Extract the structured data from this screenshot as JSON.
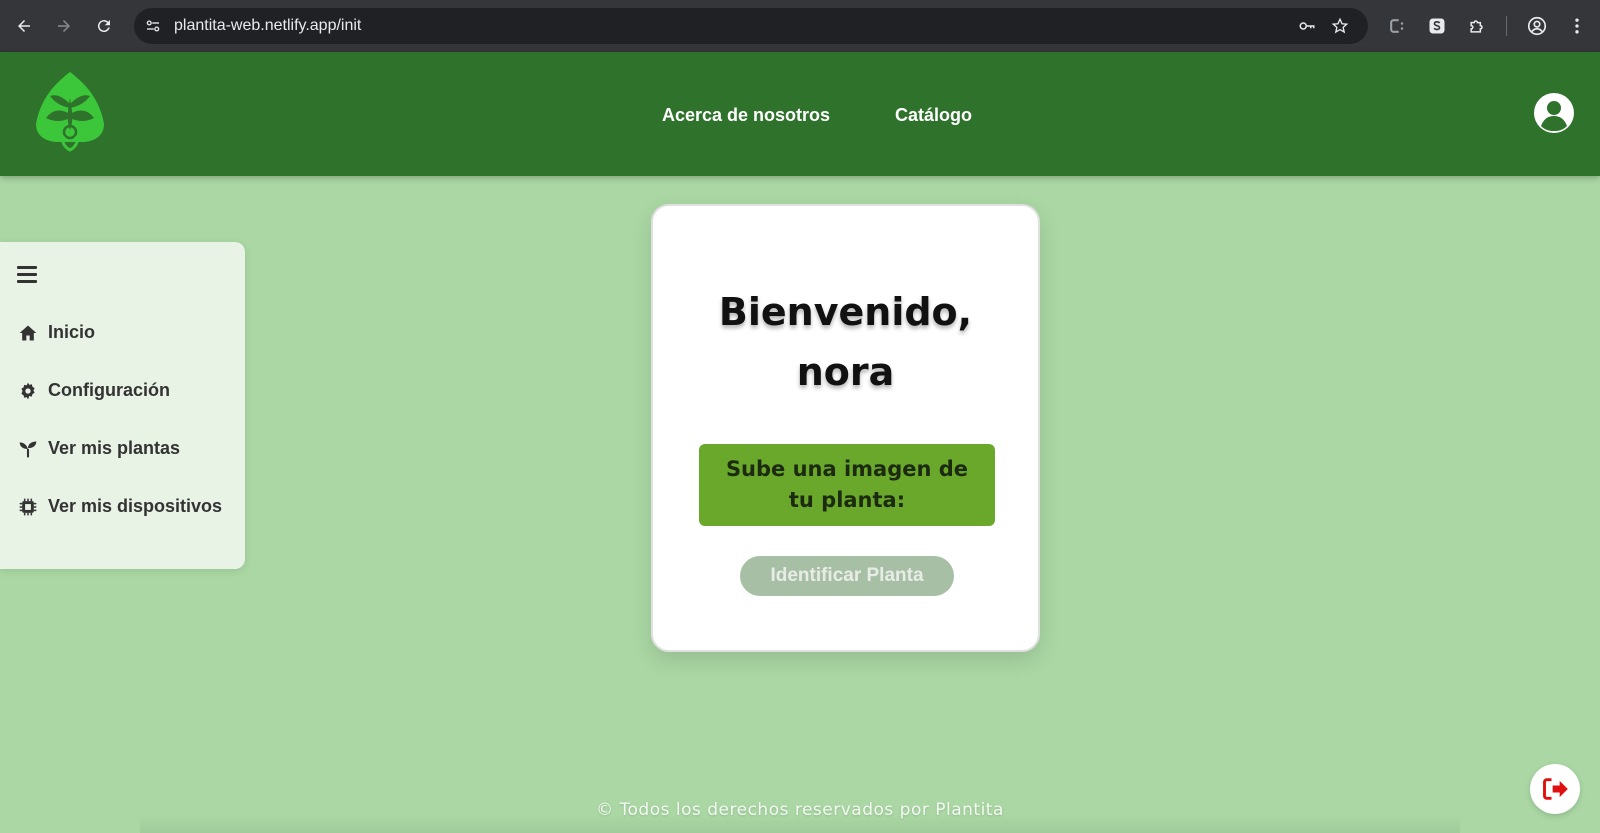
{
  "browser": {
    "url": "plantita-web.netlify.app/init",
    "icons": [
      "back-arrow-icon",
      "forward-arrow-icon",
      "reload-icon",
      "site-settings-icon",
      "password-key-icon",
      "bookmark-star-icon",
      "extension-c-icon",
      "extension-s-icon",
      "extensions-puzzle-icon",
      "profile-icon",
      "menu-dots-icon"
    ]
  },
  "header": {
    "nav": [
      {
        "label": "Acerca de nosotros"
      },
      {
        "label": "Catálogo"
      }
    ],
    "colors": {
      "background": "#2e722b",
      "logo": "#3cc63a"
    }
  },
  "sidebar": {
    "items": [
      {
        "label": "Inicio",
        "icon": "home-icon"
      },
      {
        "label": "Configuración",
        "icon": "gear-icon"
      },
      {
        "label": "Ver mis plantas",
        "icon": "sprout-icon"
      },
      {
        "label": "Ver mis dispositivos",
        "icon": "chip-icon"
      }
    ]
  },
  "card": {
    "welcome_line1": "Bienvenido,",
    "welcome_line2": "nora",
    "upload_label": "Sube una imagen de tu planta:",
    "identify_button": "Identificar Planta"
  },
  "footer": {
    "text": "© Todos los derechos reservados por Plantita"
  },
  "colors": {
    "page_background": "#aad7a4",
    "upload_box": "#6aa82b",
    "identify_button_disabled": "#a7c0a5",
    "logout_icon": "#e01010"
  }
}
